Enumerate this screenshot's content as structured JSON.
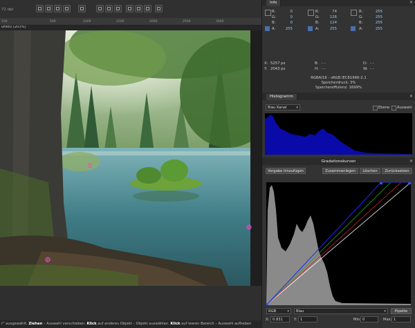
{
  "toolbar": {
    "document_title": "unktl) (203%)",
    "dpi_value": "72 dpi"
  },
  "ruler": {
    "ticks": [
      "100",
      "500",
      "1000",
      "1500",
      "2000",
      "2500",
      "3000"
    ]
  },
  "status_bar": {
    "prefix": "r\" ausgewählt. ",
    "k1": "Ziehen",
    "t1": " – Auswahl verschieben. ",
    "k2": "Klick",
    "t2": " auf anderes Objekt – Objekt auswählen. ",
    "k3": "Klick",
    "t3": " auf leeren Bereich – Auswahl aufheben"
  },
  "info": {
    "tab_label": "Info",
    "col1": {
      "r": "0",
      "g": "0",
      "b": "0",
      "a": "255"
    },
    "col2": {
      "r": "74",
      "g": "126",
      "b": "124",
      "a": "255"
    },
    "col3": {
      "r": "255",
      "g": "255",
      "b": "255",
      "a": "255"
    },
    "labels": {
      "r": "R:",
      "g": "G:",
      "b": "B:",
      "a": "A:"
    },
    "x_label": "X:",
    "x_value": "5257 px",
    "y_label": "Y:",
    "y_value": "2043 px",
    "w_label": "B:",
    "w_value": "- -",
    "h_label": "H:",
    "h_value": "- -",
    "d_label": "D:",
    "d_value": "- -",
    "win_label": "W:",
    "win_value": "- -",
    "color_profile": "RGBA/16 - sRGB IEC61966-2.1",
    "memory_usage": "Speicherdruck: 3%",
    "memory_efficiency": "Speichereffizienz: 1699%"
  },
  "histogram": {
    "tab_label": "Histogramm",
    "channel": "Blau Kanal",
    "option1": "Ebene",
    "option2": "Auswahl",
    "warning_icon": "warning-icon"
  },
  "curves": {
    "title": "Gradationskurven",
    "btn_add_preset": "Vorgabe hinzufügen",
    "btn_merge": "Zusammenlegen",
    "btn_delete": "Löschen",
    "btn_reset": "Zurücksetzen",
    "color_space": "RGB",
    "channel": "Blau",
    "btn_picker": "Pipette",
    "x_label": "X:",
    "x_value": "0.831",
    "y_label": "Y:",
    "y_value": "1",
    "min_label": "Min:",
    "min_value": "0",
    "max_label": "Max:",
    "max_value": "1"
  },
  "colors": {
    "accent_blue": "#0000cc",
    "histogram_fill": "#0a0aa8",
    "value_blue": "#9ec9ff"
  }
}
